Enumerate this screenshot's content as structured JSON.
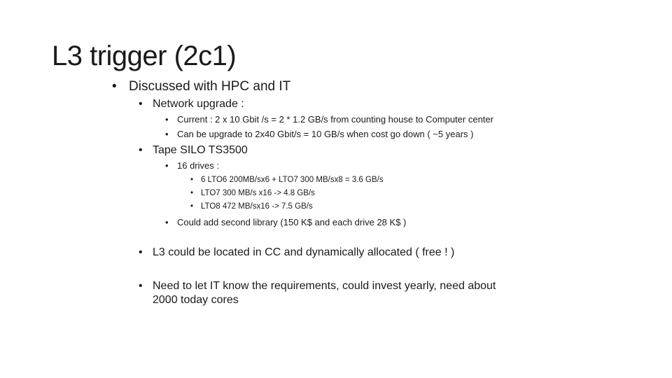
{
  "slide": {
    "title": "L3 trigger (2c1)",
    "bullet_glyph": "•",
    "items": [
      {
        "level": 1,
        "text": "Discussed with HPC and IT"
      },
      {
        "level": 2,
        "text": "Network upgrade :"
      },
      {
        "level": 3,
        "text": "Current : 2 x 10 Gbit /s = 2 * 1.2 GB/s from counting house to Computer center"
      },
      {
        "level": 3,
        "text": "Can be upgrade to 2x40 Gbit/s = 10 GB/s when cost go down ( ~5 years )"
      },
      {
        "level": 2,
        "text": "Tape SILO TS3500"
      },
      {
        "level": 3,
        "text": "16 drives :"
      },
      {
        "level": 4,
        "text": "6 LTO6  200MB/sx6 + LTO7 300 MB/sx8 = 3.6 GB/s"
      },
      {
        "level": 4,
        "text": "LTO7 300 MB/s x16 -> 4.8 GB/s"
      },
      {
        "level": 4,
        "text": "LTO8  472 MB/sx16 -> 7.5 GB/s"
      },
      {
        "level": 3,
        "text": "Could add second library  (150 K$ and each drive 28 K$ )"
      },
      {
        "level": 2,
        "text": "L3 could be located in CC and dynamically allocated ( free ! )"
      },
      {
        "level": 2,
        "text": "Need to let IT know the requirements, could invest yearly, need about",
        "continuation": "2000  today cores"
      }
    ]
  }
}
